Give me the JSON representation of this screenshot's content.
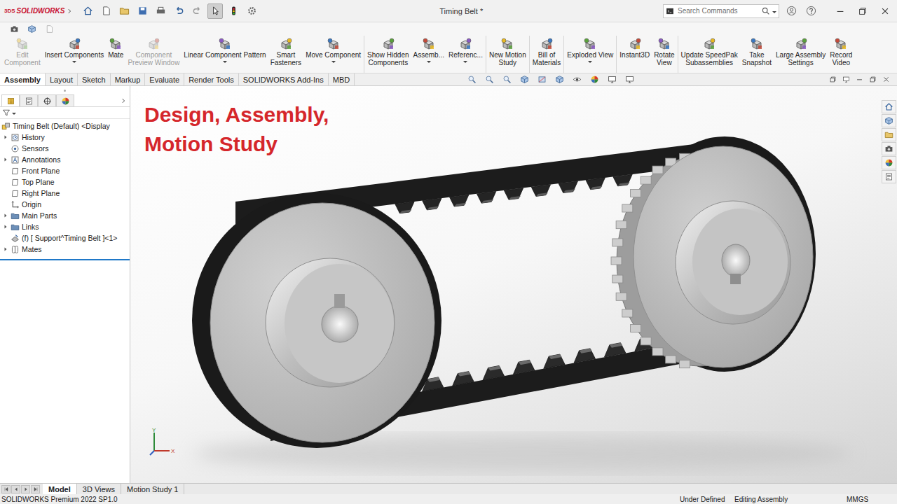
{
  "app": {
    "logo_mark": "3DS",
    "logo": "SOLIDWORKS",
    "title": "Timing Belt *",
    "search": {
      "placeholder": "Search Commands"
    }
  },
  "ribbon": {
    "groups": [
      {
        "buttons": [
          {
            "lines": [
              "Edit",
              "Component"
            ],
            "disabled": true,
            "dropdown": false
          },
          {
            "lines": [
              "Insert Components"
            ],
            "disabled": false,
            "dropdown": true
          },
          {
            "lines": [
              "Mate"
            ],
            "disabled": false,
            "dropdown": false
          },
          {
            "lines": [
              "Component",
              "Preview Window"
            ],
            "disabled": true,
            "dropdown": false
          },
          {
            "lines": [
              "Linear Component Pattern"
            ],
            "disabled": false,
            "dropdown": true
          },
          {
            "lines": [
              "Smart",
              "Fasteners"
            ],
            "disabled": false,
            "dropdown": false
          },
          {
            "lines": [
              "Move Component"
            ],
            "disabled": false,
            "dropdown": true
          }
        ]
      },
      {
        "buttons": [
          {
            "lines": [
              "Show Hidden",
              "Components"
            ],
            "disabled": false,
            "dropdown": false
          },
          {
            "lines": [
              "Assemb..."
            ],
            "disabled": false,
            "dropdown": true
          },
          {
            "lines": [
              "Referenc..."
            ],
            "disabled": false,
            "dropdown": true
          }
        ]
      },
      {
        "buttons": [
          {
            "lines": [
              "New Motion",
              "Study"
            ],
            "disabled": false,
            "dropdown": false
          }
        ]
      },
      {
        "buttons": [
          {
            "lines": [
              "Bill of",
              "Materials"
            ],
            "disabled": false,
            "dropdown": false
          }
        ]
      },
      {
        "buttons": [
          {
            "lines": [
              "Exploded View"
            ],
            "disabled": false,
            "dropdown": true
          }
        ]
      },
      {
        "buttons": [
          {
            "lines": [
              "Instant3D"
            ],
            "disabled": false,
            "dropdown": false
          },
          {
            "lines": [
              "Rotate",
              "View"
            ],
            "disabled": false,
            "dropdown": false
          }
        ]
      },
      {
        "buttons": [
          {
            "lines": [
              "Update SpeedPak",
              "Subassemblies"
            ],
            "disabled": false,
            "dropdown": false
          },
          {
            "lines": [
              "Take",
              "Snapshot"
            ],
            "disabled": false,
            "dropdown": false
          },
          {
            "lines": [
              "Large Assembly",
              "Settings"
            ],
            "disabled": false,
            "dropdown": false
          },
          {
            "lines": [
              "Record",
              "Video"
            ],
            "disabled": false,
            "dropdown": false
          }
        ]
      }
    ]
  },
  "tabs": [
    {
      "label": "Assembly",
      "selected": true
    },
    {
      "label": "Layout",
      "selected": false
    },
    {
      "label": "Sketch",
      "selected": false
    },
    {
      "label": "Markup",
      "selected": false
    },
    {
      "label": "Evaluate",
      "selected": false
    },
    {
      "label": "Render Tools",
      "selected": false
    },
    {
      "label": "SOLIDWORKS Add-Ins",
      "selected": false
    },
    {
      "label": "MBD",
      "selected": false
    }
  ],
  "feature_tree": {
    "root": "Timing Belt (Default) <Display",
    "items": [
      {
        "label": "History",
        "kind": "history",
        "expandable": true
      },
      {
        "label": "Sensors",
        "kind": "sensor",
        "expandable": false
      },
      {
        "label": "Annotations",
        "kind": "annotation",
        "expandable": true
      },
      {
        "label": "Front Plane",
        "kind": "plane",
        "expandable": false
      },
      {
        "label": "Top Plane",
        "kind": "plane",
        "expandable": false
      },
      {
        "label": "Right Plane",
        "kind": "plane",
        "expandable": false
      },
      {
        "label": "Origin",
        "kind": "origin",
        "expandable": false
      },
      {
        "label": "Main Parts",
        "kind": "folder",
        "expandable": true
      },
      {
        "label": "Links",
        "kind": "folder",
        "expandable": true
      },
      {
        "label": "(f) [ Support^Timing Belt ]<1>",
        "kind": "part",
        "expandable": false
      },
      {
        "label": "Mates",
        "kind": "mates",
        "expandable": true
      }
    ]
  },
  "graphics": {
    "overlay_title": [
      "Design, Assembly,",
      "Motion Study"
    ],
    "triad": {
      "y": "Y",
      "x": "X"
    }
  },
  "bottom_tabs": [
    {
      "label": "Model",
      "selected": true
    },
    {
      "label": "3D Views",
      "selected": false
    },
    {
      "label": "Motion Study 1",
      "selected": false
    }
  ],
  "status_bar": {
    "product": "SOLIDWORKS Premium 2022 SP1.0",
    "state": "Under Defined",
    "mode": "Editing Assembly",
    "units": "MMGS"
  }
}
